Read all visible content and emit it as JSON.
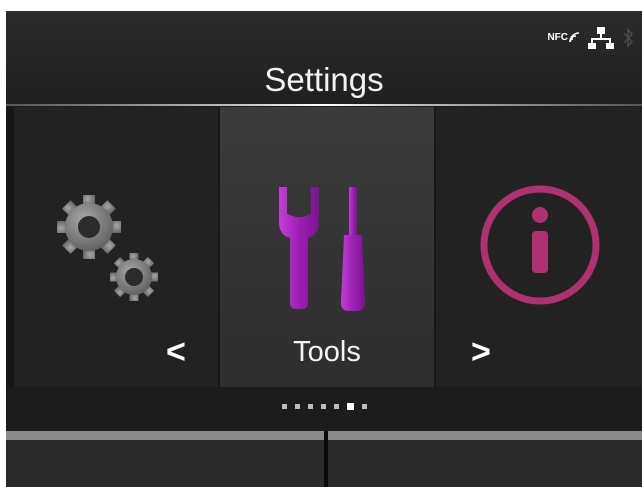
{
  "header": {
    "title": "Settings",
    "status_icons": {
      "nfc_label": "NFC",
      "nfc_icon": "nfc-icon",
      "network_icon": "network-icon",
      "bluetooth_icon": "bluetooth-icon"
    }
  },
  "carousel": {
    "prev_label": "<",
    "next_label": ">",
    "items": [
      {
        "icon": "gears-icon",
        "label": ""
      },
      {
        "icon": "tools-icon",
        "label": "Tools"
      },
      {
        "icon": "info-icon",
        "label": ""
      }
    ],
    "page_count": 7,
    "active_page": 6
  },
  "colors": {
    "tools_purple": "#9c1fb3",
    "info_pink": "#b0316f",
    "gear_gray": "#8a8a8a"
  }
}
